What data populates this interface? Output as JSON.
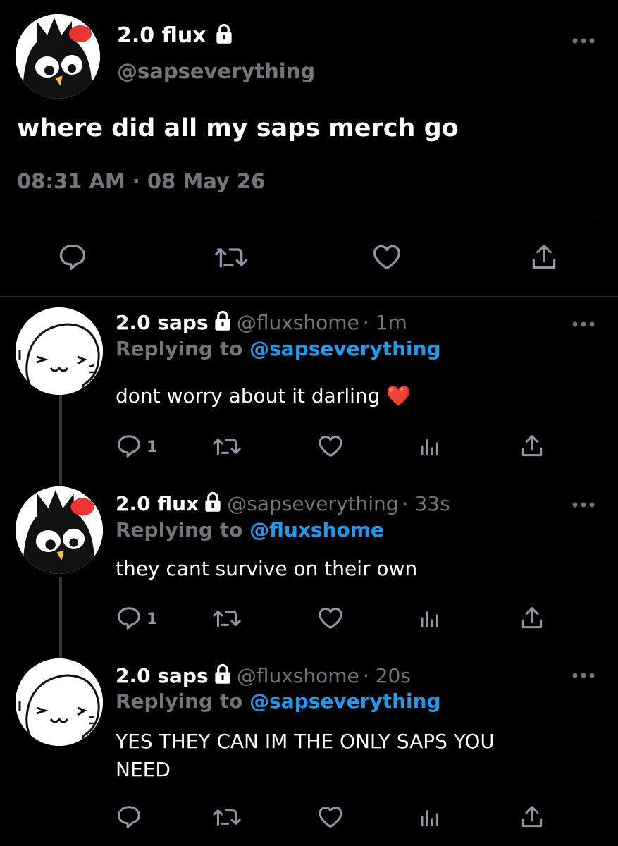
{
  "main_tweet": {
    "display_name": "2.0 flux",
    "handle": "@sapseverything",
    "text": "where did all my saps merch go",
    "timestamp": "08:31 AM · 08 May 26",
    "avatar_icon": "badtz-maru-avatar",
    "actions": [
      "reply-icon",
      "retweet-icon",
      "like-icon",
      "share-icon"
    ]
  },
  "replies": [
    {
      "display_name": "2.0 saps",
      "handle": "@fluxshome",
      "time": "· 1m",
      "replying_label": "Replying to",
      "replying_to": "@sapseverything",
      "text": "dont worry about it darling ❤️",
      "reply_count": "1",
      "avatar_icon": "white-seal-avatar"
    },
    {
      "display_name": "2.0 flux",
      "handle": "@sapseverything",
      "time": "· 33s",
      "replying_label": "Replying to",
      "replying_to": "@fluxshome",
      "text": "they cant survive on their own",
      "reply_count": "1",
      "avatar_icon": "badtz-maru-avatar"
    },
    {
      "display_name": "2.0 saps",
      "handle": "@fluxshome",
      "time": "· 20s",
      "replying_label": "Replying to",
      "replying_to": "@sapseverything",
      "text_line1": "YES THEY CAN IM THE ONLY SAPS YOU",
      "text_line2": "NEED",
      "reply_count": "",
      "avatar_icon": "white-seal-avatar"
    }
  ],
  "colors": {
    "background": "#000000",
    "secondary_text": "#71767b",
    "accent_blue": "#1d9bf0",
    "divider": "#2f3336"
  }
}
